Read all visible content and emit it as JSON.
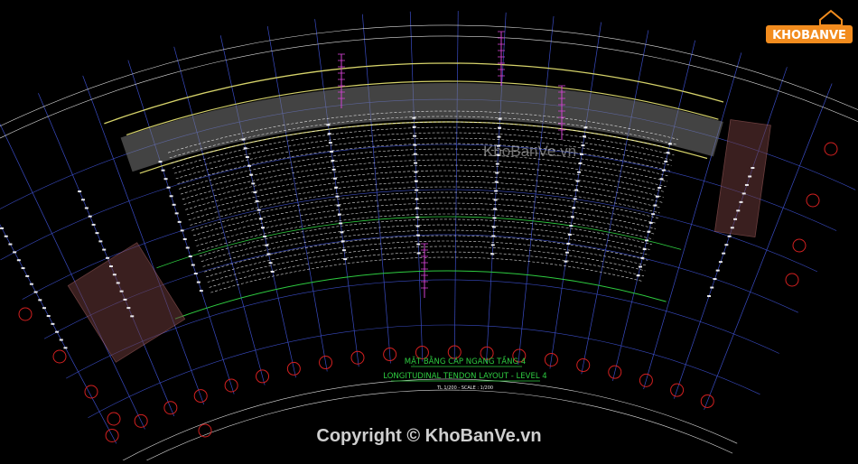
{
  "drawing": {
    "title_vi": "MẶT BẰNG CÁP NGANG TẦNG 4",
    "title_en": "LONGITUDINAL TENDON LAYOUT - LEVEL 4",
    "scale_note": "TL 1/200 - SCALE : 1/200"
  },
  "brand": {
    "logo_text": "KHOBANVE",
    "watermark": "KhoBanVe.vn",
    "copyright": "Copyright © KhoBanVe.vn"
  },
  "colors": {
    "background": "#000000",
    "grid": "#3a4cc4",
    "slab": "#d6d36a",
    "hatch": "#7a7a7a",
    "tendon": "#ffffff",
    "magenta": "#d040d0",
    "green_title": "#2ecc40",
    "bubble": "#d22020",
    "logo_orange": "#f28c1e"
  }
}
